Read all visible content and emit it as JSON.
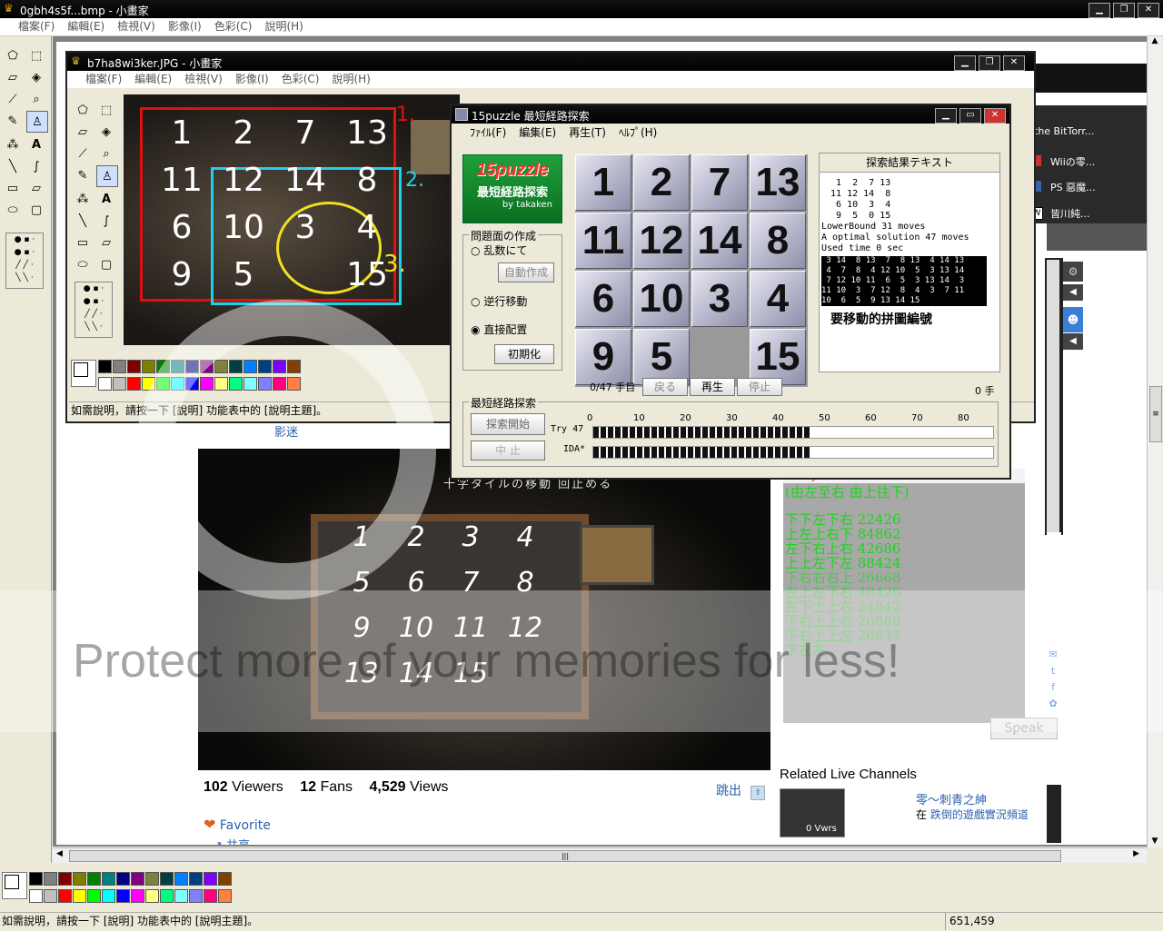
{
  "outer": {
    "title": "0gbh4s5f...bmp - 小畫家",
    "menu": [
      "檔案(F)",
      "編輯(E)",
      "檢視(V)",
      "影像(I)",
      "色彩(C)",
      "說明(H)"
    ],
    "status": "如需說明，請按一下 [說明] 功能表中的 [說明主題]。",
    "coords": "651,459"
  },
  "inner": {
    "title": "b7ha8wi3ker.JPG - 小畫家",
    "menu": [
      "檔案(F)",
      "編輯(E)",
      "檢視(V)",
      "影像(I)",
      "色彩(C)",
      "說明(H)"
    ],
    "status": "如需說明，請按一下 [說明] 功能表中的 [說明主題]。",
    "handwritten": {
      "row1": [
        "1",
        "2",
        "7",
        "13"
      ],
      "row2": [
        "11",
        "12",
        "14",
        "8"
      ],
      "row3": [
        "6",
        "10",
        "3",
        "4"
      ],
      "row4": [
        "9",
        "5",
        "15"
      ],
      "markers": [
        "1.",
        "2.",
        "3."
      ]
    }
  },
  "puzzle": {
    "title": "15puzzle 最短経路探索",
    "menu": [
      "ﾌｧｲﾙ(F)",
      "編集(E)",
      "再生(T)",
      "ﾍﾙﾌﾟ(H)"
    ],
    "logo": {
      "title": "15puzzle",
      "subtitle": "最短経路探索",
      "by": "by takaken"
    },
    "group_create": "問題面の作成",
    "radio_random": "乱数にて",
    "btn_auto": "自動作成",
    "radio_reverse": "逆行移動",
    "radio_direct": "直接配置",
    "btn_init": "初期化",
    "tiles": [
      "1",
      "2",
      "7",
      "13",
      "11",
      "12",
      "14",
      "8",
      "6",
      "10",
      "3",
      "4",
      "9",
      "5",
      "",
      "15"
    ],
    "progress_label": "0/47 手目",
    "btn_back": "戻る",
    "btn_play": "再生",
    "btn_stop": "停止",
    "moves_count": "0 手",
    "search_group": "最短経路探索",
    "btn_search_start": "探索開始",
    "btn_search_stop": "中 止",
    "try_label": "Try 47",
    "ida_label": "IDA*",
    "scale": [
      "0",
      "10",
      "20",
      "30",
      "40",
      "50",
      "60",
      "70",
      "80"
    ],
    "result_header": "探索結果テキスト",
    "result_grid": "  1  2  7 13\n 11 12 14  8\n  6 10  3  4\n  9  5  0 15",
    "result_lines": [
      "LowerBound 31 moves",
      "A optimal solution 47 moves",
      "Used time 0 sec"
    ],
    "solution": " 3 14  8 13  7  8 13  4 14 13\n 4  7  8  4 12 10  5  3 13 14\n 7 12 10 11  6  5  3 13 14  3\n11 10  3  7 12  8  4  3  7 11\n10  6  5  9 13 14 15",
    "annotation": "要移動的拼圖編號"
  },
  "web": {
    "sidebar_links": [
      "the BitTorr...",
      "Wiiの零...",
      "PS 惡魔...",
      "皆川純..."
    ],
    "fan_label": "影迷",
    "video_caption": "十字タイルの移動 回止める",
    "video_handwritten": [
      "1",
      "2",
      "3",
      "4",
      "5",
      "6",
      "7",
      "8",
      "9",
      "10",
      "11",
      "12",
      "13",
      "14",
      "15"
    ],
    "chat_user": "Teddy293: 248",
    "chat_header": "(由左至右 由上往下)",
    "chat_lines": [
      "下下左下右 22426",
      "上左上右下 84862",
      "左下右上右 42686",
      "上上左下左 88424",
      "下右右右上 26668",
      "左上左下右 48426",
      "左下上上右 24842",
      "下右上上右 26886",
      "下右上上左 26834",
      "下左左"
    ],
    "viewers_num": "102",
    "viewers_label": "Viewers",
    "fans_num": "12",
    "fans_label": "Fans",
    "views_num": "4,529",
    "views_label": "Views",
    "jump": "跳出",
    "favorite": "Favorite",
    "share": "共享",
    "speak": "Speak",
    "related_title": "Related Live Channels",
    "related_name": "零～刺青之紳",
    "related_in": "在",
    "related_channel": "跌倒的遊戲實況頻道",
    "related_viewers": "0 Vwrs",
    "corner_char": "下"
  },
  "watermark": "Protect more of your memories for less!"
}
